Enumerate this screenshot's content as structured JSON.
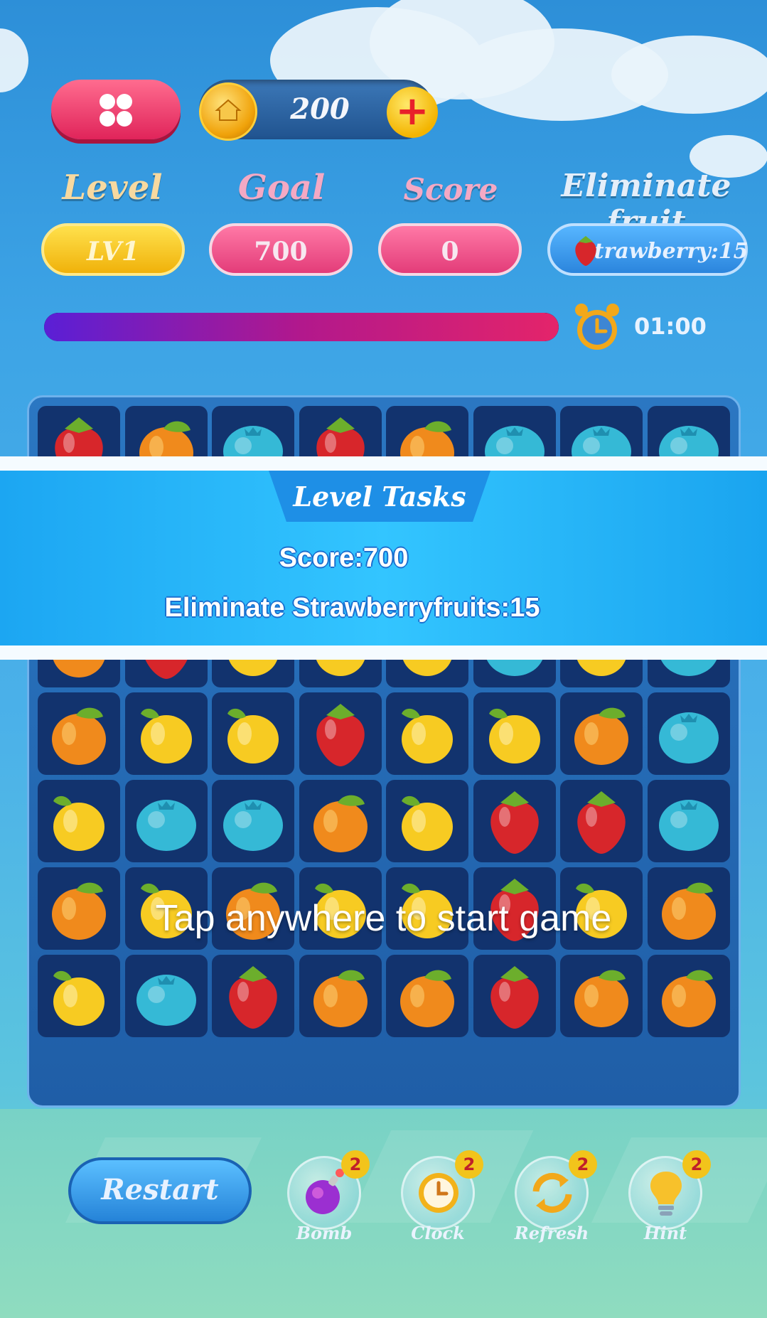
{
  "top_bar": {
    "menu_icon": "clover-menu-icon",
    "coins": "200",
    "add_coins_label": "+"
  },
  "stats": {
    "level_header": "Level",
    "goal_header": "Goal",
    "score_header": "Score",
    "eliminate_header": "Eliminate fruit",
    "level_value": "LV1",
    "goal_value": "700",
    "score_value": "0",
    "eliminate_value": "Strawberry:15"
  },
  "progress": {
    "fraction": 1.0,
    "timer": "01:00"
  },
  "level_tasks": {
    "title": "Level Tasks",
    "line1": "Score:700",
    "line2": "Eliminate Strawberryfruits:15"
  },
  "overlay_prompt": "Tap anywhere to start game",
  "board": {
    "columns": 8,
    "rows": [
      [
        "strawberry",
        "orange",
        "blueberry",
        "strawberry",
        "orange",
        "blueberry",
        "blueberry",
        "blueberry"
      ],
      [
        "orange",
        "strawberry",
        "lemon",
        "lemon",
        "lemon",
        "blueberry",
        "lemon",
        "blueberry"
      ],
      [
        "orange",
        "lemon",
        "lemon",
        "strawberry",
        "lemon",
        "lemon",
        "orange",
        "blueberry"
      ],
      [
        "lemon",
        "blueberry",
        "blueberry",
        "orange",
        "lemon",
        "strawberry",
        "strawberry",
        "blueberry"
      ],
      [
        "orange",
        "lemon",
        "orange",
        "lemon",
        "lemon",
        "strawberry",
        "lemon",
        "orange"
      ],
      [
        "lemon",
        "blueberry",
        "strawberry",
        "orange",
        "orange",
        "strawberry",
        "orange",
        "orange"
      ]
    ]
  },
  "controls": {
    "restart_label": "Restart",
    "tools": [
      {
        "label": "Bomb",
        "count": "2",
        "icon": "bomb-icon"
      },
      {
        "label": "Clock",
        "count": "2",
        "icon": "clock-icon"
      },
      {
        "label": "Refresh",
        "count": "2",
        "icon": "refresh-icon"
      },
      {
        "label": "Hint",
        "count": "2",
        "icon": "lightbulb-icon"
      }
    ]
  },
  "colors": {
    "strawberry": "#d7262b",
    "orange": "#f08a1c",
    "lemon": "#f7cb22",
    "blueberry": "#35b9d6",
    "leaf": "#6cae2c"
  }
}
